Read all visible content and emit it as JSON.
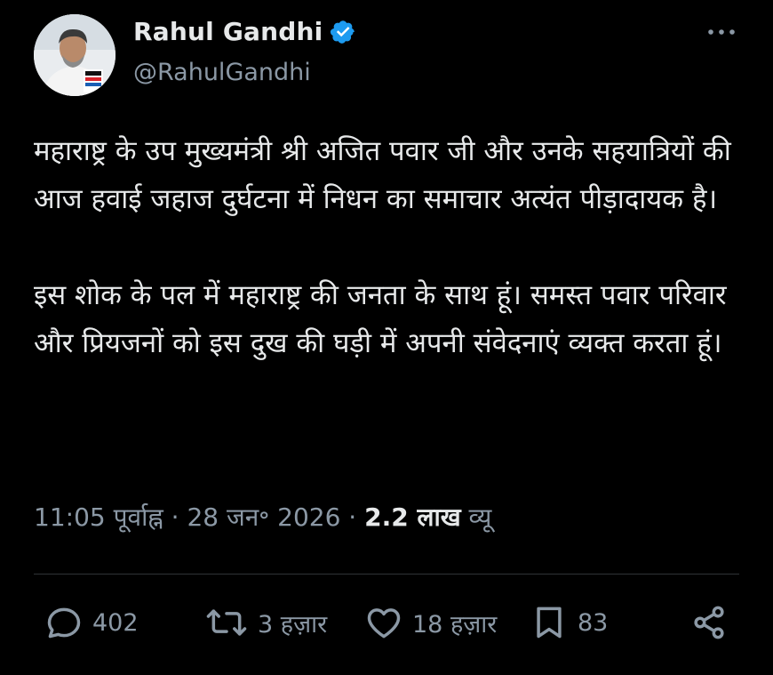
{
  "author": {
    "name": "Rahul Gandhi",
    "handle": "@RahulGandhi"
  },
  "tweet": {
    "paragraphs": [
      "महाराष्ट्र के उप मुख्यमंत्री श्री अजित पवार जी और उनके सहयात्रियों की आज हवाई जहाज दुर्घटना में निधन का समाचार अत्यंत पीड़ादायक है।",
      "इस शोक के पल में महाराष्ट्र की जनता के साथ हूं। समस्त पवार परिवार और प्रियजनों को इस दुख की घड़ी में अपनी संवेदनाएं व्यक्त करता हूं।"
    ]
  },
  "meta": {
    "time": "11:05 पूर्वाह्न",
    "sep1": "·",
    "date": "28 जन॰ 2026",
    "sep2": "·",
    "views_count": "2.2 लाख",
    "views_label": "व्यू"
  },
  "actions": {
    "replies": "402",
    "reposts": "3 हज़ार",
    "likes": "18 हज़ार",
    "bookmarks": "83"
  },
  "colors": {
    "background": "#000000",
    "text": "#e7e9ea",
    "muted": "#8b98a5",
    "verified_badge": "#1d9bf0",
    "divider": "#2f3336"
  },
  "icons": [
    "verified-badge-icon",
    "more-icon",
    "reply-icon",
    "repost-icon",
    "like-icon",
    "bookmark-icon",
    "share-icon"
  ]
}
